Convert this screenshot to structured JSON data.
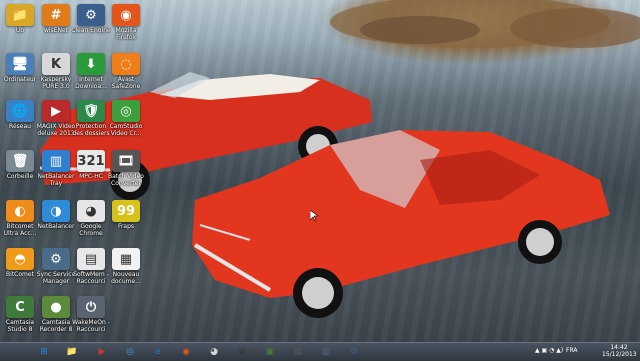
{
  "desktop_icons": [
    {
      "id": "usb",
      "label": "Ub",
      "color": "#d9a728",
      "glyph": "📁"
    },
    {
      "id": "wisenet",
      "label": "wisENet",
      "color": "#e07b1a",
      "glyph": "#"
    },
    {
      "id": "cleanengine",
      "label": "Clean Engine",
      "color": "#3a5f8c",
      "glyph": "⚙"
    },
    {
      "id": "firefox",
      "label": "Mozilla Firefox",
      "color": "#e2561b",
      "glyph": "◉"
    },
    {
      "id": "ordinateur",
      "label": "Ordinateur",
      "color": "#4b7fb8",
      "glyph": "🖥"
    },
    {
      "id": "kaspersky",
      "label": "Kaspersky PURE 3.0",
      "color": "#d8d8d8",
      "glyph": "K"
    },
    {
      "id": "internetdl",
      "label": "Internet Downloa...",
      "color": "#2a9b3a",
      "glyph": "⬇"
    },
    {
      "id": "avast",
      "label": "Avast SafeZone",
      "color": "#f07d18",
      "glyph": "◌"
    },
    {
      "id": "reseau",
      "label": "Réseau",
      "color": "#3a80c4",
      "glyph": "🌐"
    },
    {
      "id": "magix",
      "label": "MAGIX Video deluxe 2013",
      "color": "#ba2a2a",
      "glyph": "▶"
    },
    {
      "id": "protection",
      "label": "Protection des dossiers",
      "color": "#2b8a4a",
      "glyph": "🛡"
    },
    {
      "id": "camstudio",
      "label": "CamStudio Video Cr...",
      "color": "#3c9e3c",
      "glyph": "◎"
    },
    {
      "id": "corbeille",
      "label": "Corbeille",
      "color": "#7a8a95",
      "glyph": "🗑"
    },
    {
      "id": "netbalancer_tray",
      "label": "NetBalancer Tray",
      "color": "#2e7fcf",
      "glyph": "▥"
    },
    {
      "id": "mpchc",
      "label": "MPC-HC",
      "color": "#e8e8e8",
      "glyph": "321"
    },
    {
      "id": "batch",
      "label": "Batch Video Converter",
      "color": "#555",
      "glyph": "🎞"
    },
    {
      "id": "bitcomet_ultra",
      "label": "Bitcomet Ultra Acc...",
      "color": "#f08c1a",
      "glyph": "◐"
    },
    {
      "id": "netbalancer",
      "label": "NetBalancer",
      "color": "#2f8bd8",
      "glyph": "◑"
    },
    {
      "id": "chrome",
      "label": "Google Chrome",
      "color": "#e6e6e6",
      "glyph": "◕"
    },
    {
      "id": "fraps",
      "label": "Fraps",
      "color": "#d6c21a",
      "glyph": "99"
    },
    {
      "id": "bitcomet",
      "label": "BitComet",
      "color": "#f09a1a",
      "glyph": "◓"
    },
    {
      "id": "syncservice",
      "label": "Sync Service Manager",
      "color": "#4a6a8a",
      "glyph": "⚙"
    },
    {
      "id": "softwmem",
      "label": "SoftwMem - Raccourci",
      "color": "#e8e8e8",
      "glyph": "▤"
    },
    {
      "id": "nouveau",
      "label": "Nouveau docume...",
      "color": "#f2f2f2",
      "glyph": "▦"
    },
    {
      "id": "camtasia8",
      "label": "Camtasia Studio 8",
      "color": "#3f7a3a",
      "glyph": "C"
    },
    {
      "id": "camtasia_rec",
      "label": "Camtasia Recorder 8",
      "color": "#5a8a3a",
      "glyph": "●"
    },
    {
      "id": "wakemeon",
      "label": "WakeMeOn - Raccourci",
      "color": "#5a6470",
      "glyph": "⏻"
    }
  ],
  "taskbar": {
    "items": [
      {
        "id": "start",
        "glyph": "⊞",
        "color": "#1e88e5"
      },
      {
        "id": "explorer_folder",
        "glyph": "📁",
        "color": "#d9a728"
      },
      {
        "id": "media",
        "glyph": "▶",
        "color": "#c43a2a"
      },
      {
        "id": "globe",
        "glyph": "◎",
        "color": "#3aa0e0"
      },
      {
        "id": "ie",
        "glyph": "e",
        "color": "#1e7ad8"
      },
      {
        "id": "firefox",
        "glyph": "◉",
        "color": "#e2561b"
      },
      {
        "id": "chrome",
        "glyph": "◕",
        "color": "#d8d8d8"
      },
      {
        "id": "app1",
        "glyph": "▣",
        "color": "#3a3a3a"
      },
      {
        "id": "camtasia",
        "glyph": "▣",
        "color": "#4a7a3a"
      },
      {
        "id": "app2",
        "glyph": "▤",
        "color": "#5a5a5a"
      },
      {
        "id": "app3",
        "glyph": "▥",
        "color": "#4a6a8a"
      },
      {
        "id": "cleanengine",
        "glyph": "⚙",
        "color": "#3a5f8c"
      }
    ],
    "language": "FRA",
    "time": "14:42",
    "date": "15/12/2013"
  }
}
